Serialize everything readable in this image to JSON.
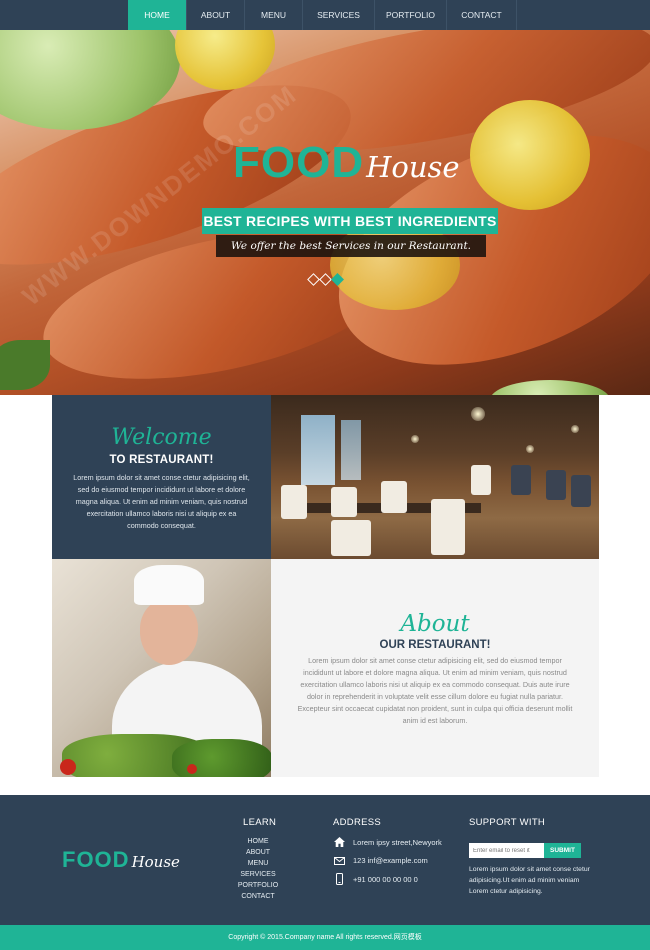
{
  "nav": {
    "items": [
      {
        "label": "HOME",
        "active": true
      },
      {
        "label": "ABOUT",
        "active": false
      },
      {
        "label": "MENU",
        "active": false
      },
      {
        "label": "SERVICES",
        "active": false
      },
      {
        "label": "PORTFOLIO",
        "active": false
      },
      {
        "label": "CONTACT",
        "active": false
      }
    ]
  },
  "brand": {
    "food": "FOOD",
    "house": "House"
  },
  "hero": {
    "tagline": "BEST RECIPES WITH BEST INGREDIENTS",
    "subtitle": "We offer the best Services in our Restaurant.",
    "slides_total": 3,
    "slide_active": 3
  },
  "welcome": {
    "script": "Welcome",
    "heading": "TO RESTAURANT!",
    "body": "Lorem ipsum dolor sit amet conse ctetur adipisicing elit, sed do eiusmod tempor incididunt ut labore et dolore magna aliqua. Ut enim ad minim veniam, quis nostrud exercitation ullamco laboris nisi ut aliquip ex ea commodo consequat."
  },
  "about": {
    "script": "About",
    "heading": "OUR RESTAURANT!",
    "body": "Lorem ipsum dolor sit amet conse ctetur adipisicing elit, sed do eiusmod tempor incididunt ut labore et dolore magna aliqua. Ut enim ad minim veniam, quis nostrud exercitation ullamco laboris nisi ut aliquip ex ea commodo consequat. Duis aute irure dolor in reprehenderit in voluptate velit esse cillum dolore eu fugiat nulla pariatur. Excepteur sint occaecat cupidatat non proident, sunt in culpa qui officia deserunt mollit anim id est laborum."
  },
  "footer": {
    "learn_title": "LEARN",
    "learn_links": [
      "HOME",
      "ABOUT",
      "MENU",
      "SERVICES",
      "PORTFOLIO",
      "CONTACT"
    ],
    "address_title": "ADDRESS",
    "address": {
      "street": "Lorem ipsy street,Newyork",
      "email": "123 inf@example.com",
      "phone": "+91 000 00 00 00 0"
    },
    "support_title": "SUPPORT WITH",
    "email_placeholder": "Enter email to reset it",
    "submit_label": "SUBMIT",
    "support_text": "Lorem ipsum dolor sit amet conse ctetur adipisicing.Ut enim ad minim veniam Lorem ctetur adipisicing."
  },
  "copyright": "Copyright © 2015.Company name All rights reserved.网页模板",
  "colors": {
    "accent": "#1fb496",
    "navy": "#2f4256",
    "light_panel": "#f4f4f4"
  },
  "watermark": "WWW.DOWNDEMO.COM"
}
